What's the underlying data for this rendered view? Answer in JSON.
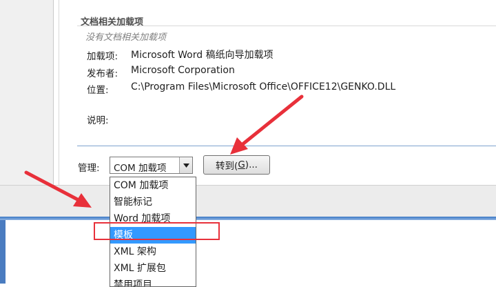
{
  "doc_addins": {
    "title": "文档相关加载项",
    "empty_text": "没有文档相关加载项"
  },
  "details": {
    "addin_label": "加载项:",
    "addin_value": "Microsoft Word 稿纸向导加载项",
    "publisher_label": "发布者:",
    "publisher_value": "Microsoft Corporation",
    "location_label": "位置:",
    "location_value": "C:\\Program Files\\Microsoft Office\\OFFICE12\\GENKO.DLL",
    "description_label": "说明:"
  },
  "manage": {
    "label": "管理:",
    "selected": "COM 加载项",
    "go_prefix": "转到(",
    "go_accel": "G",
    "go_suffix": ")...",
    "options": [
      "COM 加载项",
      "智能标记",
      "Word 加载项",
      "模板",
      "XML 架构",
      "XML 扩展包",
      "禁用项目"
    ],
    "highlighted_index": 3
  },
  "annotation_color": "#e8303a",
  "selection_color": "#3399ff"
}
